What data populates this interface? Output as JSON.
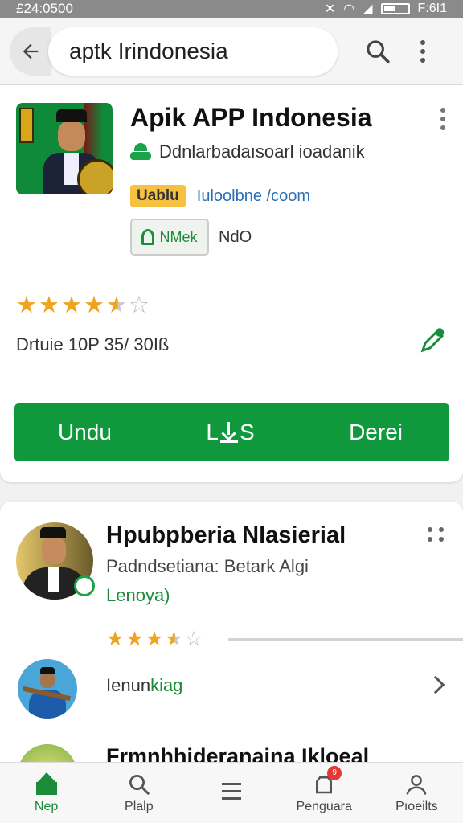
{
  "status_bar": {
    "time": "£24:0500",
    "battery_text": "F:6I1"
  },
  "search": {
    "query": "aptk Irindonesia"
  },
  "app": {
    "title": "Apik APP Indonesia",
    "developer": "Ddnlarbadaısoarl ioadanik",
    "badge": "Uablu",
    "link_text": "Iuloolbne /coom",
    "mod_chip": "NMek",
    "mod_label": "NdO",
    "rating_stars": 4.5,
    "meta": "Drtuie 10P 35/ 30Iß",
    "actions": {
      "left": "Undu",
      "middle_prefix": "L",
      "middle_suffix": "S",
      "right": "Derei"
    }
  },
  "related": {
    "title": "Hpubpberia Nlasierial",
    "subtitle": "Padndsetiana: Betark Algi",
    "green_text": "Lenoya)",
    "rating_stars": 3.5,
    "item_label_prefix": "Ienun",
    "item_label_green": "kiag",
    "cut_title": "Frmnhhideranaina Ikloeal"
  },
  "bottom_nav": [
    {
      "label": "Nep",
      "icon": "home-icon",
      "active": true
    },
    {
      "label": "Plalp",
      "icon": "search-icon",
      "active": false
    },
    {
      "label": "",
      "icon": "menu-icon",
      "active": false
    },
    {
      "label": "Penguara",
      "icon": "notification-icon",
      "active": false,
      "badge": "9"
    },
    {
      "label": "Pıoeilts",
      "icon": "profile-icon",
      "active": false
    }
  ],
  "colors": {
    "brand_green": "#10983d",
    "star": "#f0a31c",
    "link_blue": "#2a6fb8",
    "badge_yellow": "#f6c140"
  }
}
